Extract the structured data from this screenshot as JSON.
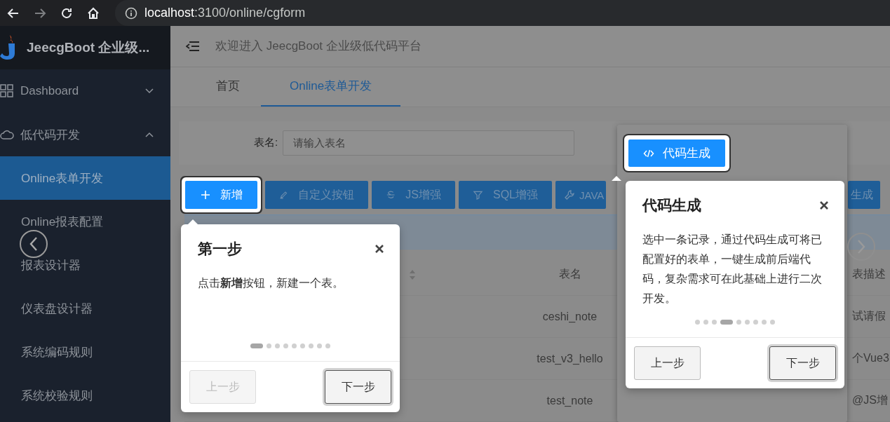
{
  "browser": {
    "url_host": "localhost",
    "url_path": ":3100/online/cgform"
  },
  "sidebar": {
    "logo_text": "JeecgBoot 企业级...",
    "items": [
      {
        "label": "Dashboard",
        "kind": "group",
        "expanded": false,
        "selected": false
      },
      {
        "label": "低代码开发",
        "kind": "group",
        "expanded": true,
        "selected": false
      },
      {
        "label": "Online表单开发",
        "kind": "item",
        "selected": true
      },
      {
        "label": "Online报表配置",
        "kind": "item",
        "selected": false
      },
      {
        "label": "报表设计器",
        "kind": "item",
        "selected": false
      },
      {
        "label": "仪表盘设计器",
        "kind": "item",
        "selected": false
      },
      {
        "label": "系统编码规则",
        "kind": "item",
        "selected": false
      },
      {
        "label": "系统校验规则",
        "kind": "item",
        "selected": false
      }
    ]
  },
  "header": {
    "welcome": "欢迎进入 JeecgBoot 企业级低代码平台"
  },
  "tabs": [
    {
      "label": "首页",
      "selected": false
    },
    {
      "label": "Online表单开发",
      "selected": true
    }
  ],
  "search": {
    "label": "表名:",
    "placeholder": "请输入表名"
  },
  "toolbar": [
    {
      "label": "新增",
      "kind": "plus",
      "highlighted": true
    },
    {
      "label": "自定义按钮",
      "kind": "brush",
      "highlighted": false
    },
    {
      "label": "JS增强",
      "kind": "strike",
      "highlighted": false
    },
    {
      "label": "SQL增强",
      "kind": "filter",
      "highlighted": false
    },
    {
      "label": "JAVA",
      "kind": "wrench",
      "highlighted": false
    },
    {
      "label": "生成",
      "kind": "none",
      "highlighted": false
    }
  ],
  "table": {
    "columns": [
      "表名",
      "表描述"
    ],
    "rows": [
      [
        "ceshi_note",
        "试请假"
      ],
      [
        "test_v3_hello",
        "个Vue3"
      ],
      [
        "test_note",
        "@JS增"
      ]
    ]
  },
  "tours": [
    {
      "title": "第一步",
      "body": "点击**新增**按钮，新建一个表。",
      "prev": {
        "label": "上一步",
        "disabled": true
      },
      "next": {
        "label": "下一步"
      },
      "steps": [
        {
          "selected": true
        },
        {
          "selected": false
        },
        {
          "selected": false
        },
        {
          "selected": false
        },
        {
          "selected": false
        },
        {
          "selected": false
        },
        {
          "selected": false
        },
        {
          "selected": false
        },
        {
          "selected": false
        }
      ]
    },
    {
      "title": "代码生成",
      "body": "选中一条记录，通过代码生成可将已配置好的表单，一键生成前后端代码，复杂需求可在此基础上进行二次开发。",
      "target": {
        "label": "代码生成",
        "kind": "code"
      },
      "prev": {
        "label": "上一步",
        "disabled": false
      },
      "next": {
        "label": "下一步"
      },
      "steps": [
        {
          "selected": false
        },
        {
          "selected": false
        },
        {
          "selected": false
        },
        {
          "selected": true
        },
        {
          "selected": false
        },
        {
          "selected": false
        },
        {
          "selected": false
        },
        {
          "selected": false
        },
        {
          "selected": false
        }
      ]
    }
  ]
}
